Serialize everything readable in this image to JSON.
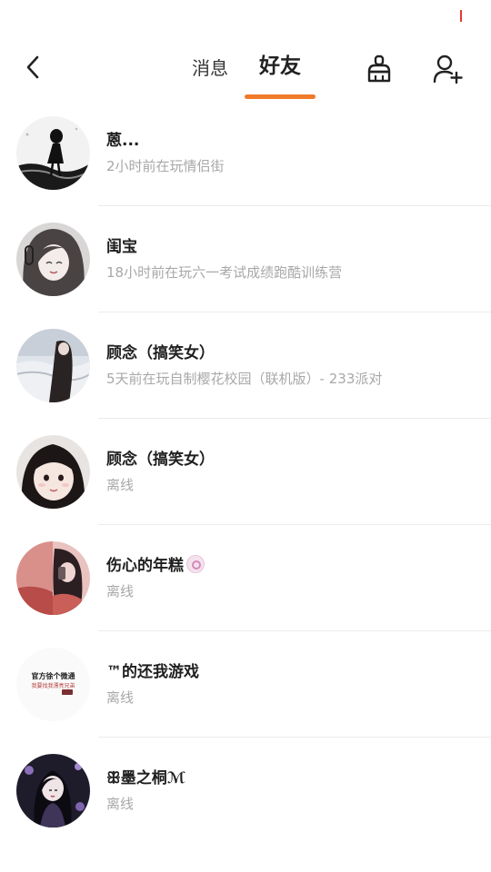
{
  "header": {
    "back_icon": "chevron-left-icon",
    "tabs": [
      {
        "label": "消息",
        "active": false
      },
      {
        "label": "好友",
        "active": true
      }
    ],
    "clean_icon": "broom-icon",
    "add_friend_icon": "add-user-icon",
    "accent_color": "#f07a2a"
  },
  "friends": [
    {
      "name": "蒽...",
      "status": "2小时前在玩情侣街"
    },
    {
      "name": "闺宝",
      "status": "18小时前在玩六一考试成绩跑酷训练营"
    },
    {
      "name": "顾念（搞笑女）",
      "status": "5天前在玩自制樱花校园（联机版）- 233派对"
    },
    {
      "name": "顾念（搞笑女）",
      "status": "离线"
    },
    {
      "name": "伤心的年糕",
      "status": "离线"
    },
    {
      "name": "™的还我游戏",
      "status": "离线"
    },
    {
      "name": "ꕥ墨之桐ℳ",
      "status": "离线"
    }
  ],
  "avatar_texts": {
    "row6_line1": "官方徐个微通",
    "row6_line2": "我要找我漂亮兄弟"
  }
}
